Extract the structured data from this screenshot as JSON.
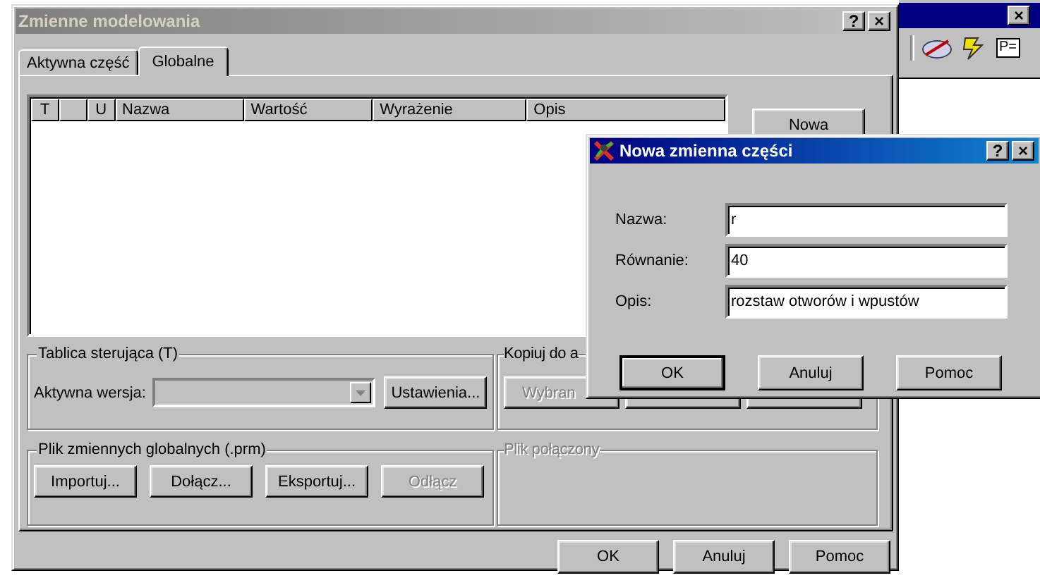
{
  "background_window": {
    "close": "×",
    "toolbar_label": "P="
  },
  "main_dialog": {
    "title": "Zmienne modelowania",
    "title_buttons": [
      "?",
      "×"
    ],
    "tabs": [
      {
        "label": "Aktywna część",
        "selected": false
      },
      {
        "label": "Globalne",
        "selected": true
      }
    ],
    "table": {
      "columns": [
        {
          "kind": "text",
          "label": "T"
        },
        {
          "kind": "blank"
        },
        {
          "kind": "text",
          "label": "U"
        },
        {
          "kind": "text",
          "label": "Nazwa"
        },
        {
          "kind": "text",
          "label": "Wartość"
        },
        {
          "kind": "text",
          "label": "Wyrażenie"
        },
        {
          "kind": "text",
          "label": "Opis"
        }
      ]
    },
    "new_button": "Nowa",
    "control_table": {
      "title": "Tablica sterująca (T)",
      "label": "Aktywna wersja:",
      "combo_disabled": true,
      "button": {
        "label": "Ustawienia..."
      }
    },
    "copy_group": {
      "title": "Kopiuj do a",
      "buttons": [
        {
          "label": "Wybran",
          "disabled": true
        }
      ]
    },
    "global_file": {
      "title": "Plik zmiennych globalnych (.prm)",
      "buttons": [
        {
          "label": "Importuj...",
          "disabled": false
        },
        {
          "label": "Dołącz...",
          "disabled": false
        },
        {
          "label": "Eksportuj...",
          "disabled": false
        },
        {
          "label": "Odłącz",
          "disabled": true
        }
      ]
    },
    "linked_file": {
      "title": "Plik połączony",
      "disabled": true
    },
    "buttons": [
      {
        "label": "OK"
      },
      {
        "label": "Anuluj"
      },
      {
        "label": "Pomoc"
      }
    ]
  },
  "sub_dialog": {
    "title": "Nowa zmienna części",
    "title_buttons": [
      "?",
      "×"
    ],
    "fields": [
      {
        "label": "Nazwa:",
        "value": "r"
      },
      {
        "label": "Równanie:",
        "value": "40"
      },
      {
        "label": "Opis:",
        "value": "rozstaw otworów i wpustów"
      }
    ],
    "buttons": [
      {
        "label": "OK",
        "default": true
      },
      {
        "label": "Anuluj",
        "default": false
      },
      {
        "label": "Pomoc",
        "default": false
      }
    ]
  }
}
